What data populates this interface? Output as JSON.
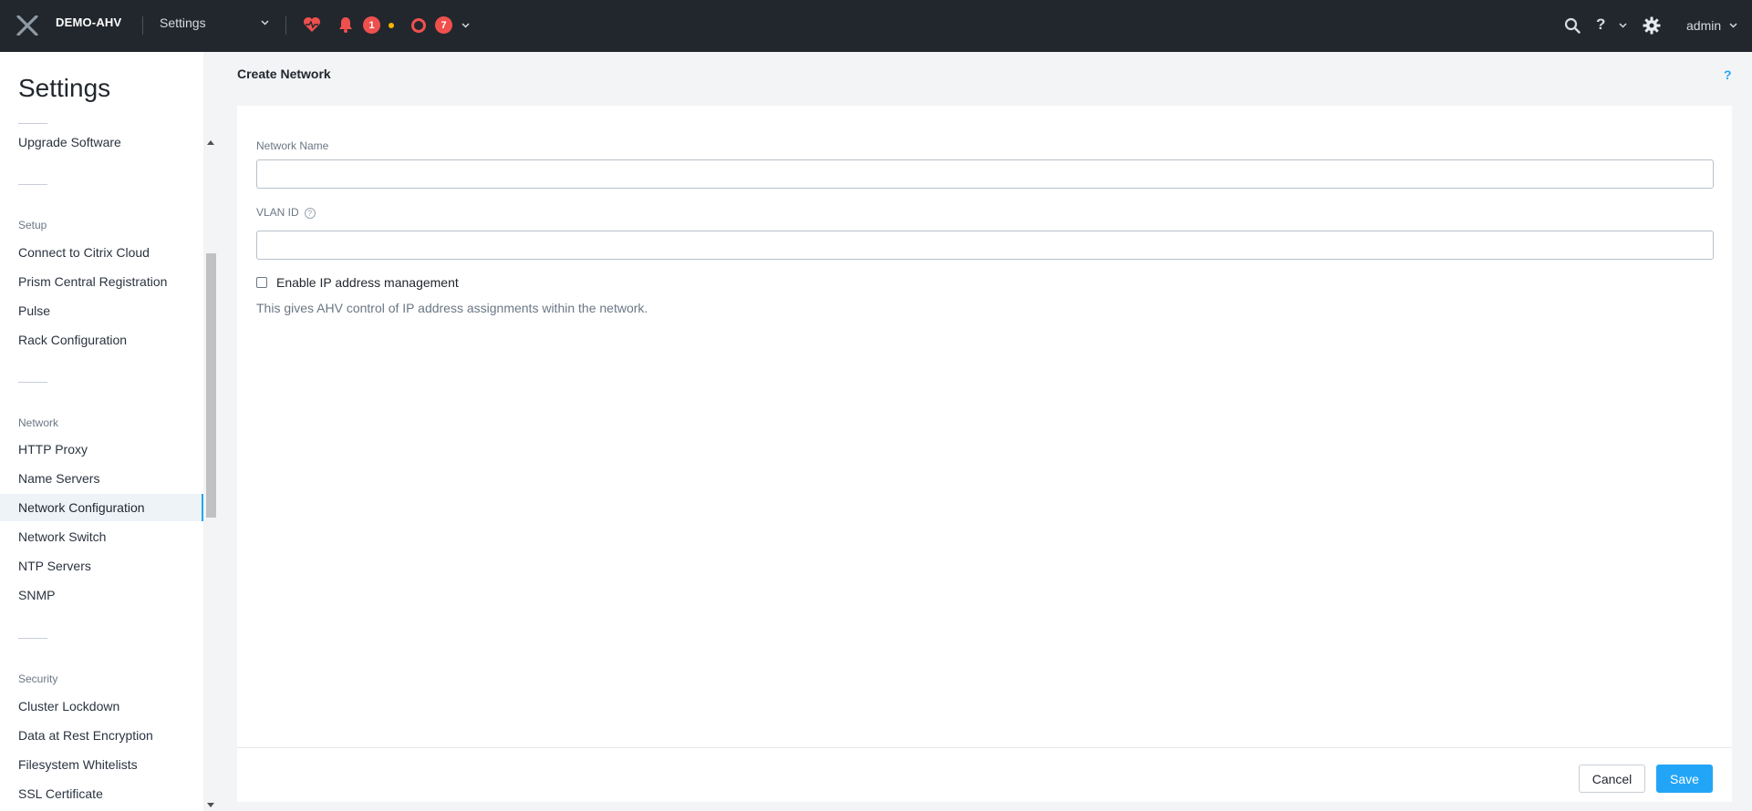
{
  "topbar": {
    "cluster_name": "DEMO-AHV",
    "section_dropdown": "Settings",
    "alerts_count": "1",
    "tasks_count": "7",
    "username": "admin"
  },
  "sidebar": {
    "title": "Settings",
    "items": {
      "upgrade_software": "Upgrade Software",
      "connect_citrix": "Connect to Citrix Cloud",
      "prism_central": "Prism Central Registration",
      "pulse": "Pulse",
      "rack_config": "Rack Configuration",
      "http_proxy": "HTTP Proxy",
      "name_servers": "Name Servers",
      "network_config": "Network Configuration",
      "network_switch": "Network Switch",
      "ntp_servers": "NTP Servers",
      "snmp": "SNMP",
      "cluster_lockdown": "Cluster Lockdown",
      "data_at_rest": "Data at Rest Encryption",
      "filesystem_whitelists": "Filesystem Whitelists",
      "ssl_certificate": "SSL Certificate"
    },
    "groups": {
      "setup": "Setup",
      "network": "Network",
      "security": "Security"
    }
  },
  "main": {
    "header": "Create Network",
    "help_link": "?",
    "form": {
      "network_name_label": "Network Name",
      "network_name_value": "",
      "vlan_id_label": "VLAN ID",
      "vlan_id_value": "",
      "ipam_checkbox_label": "Enable IP address management",
      "ipam_checkbox_checked": false,
      "ipam_help": "This gives AHV control of IP address assignments within the network."
    },
    "buttons": {
      "cancel": "Cancel",
      "save": "Save"
    }
  },
  "colors": {
    "topbar_bg": "#22272e",
    "accent": "#22a5f7",
    "alert_red": "#f0504d",
    "warning_yellow": "#f7b500"
  }
}
